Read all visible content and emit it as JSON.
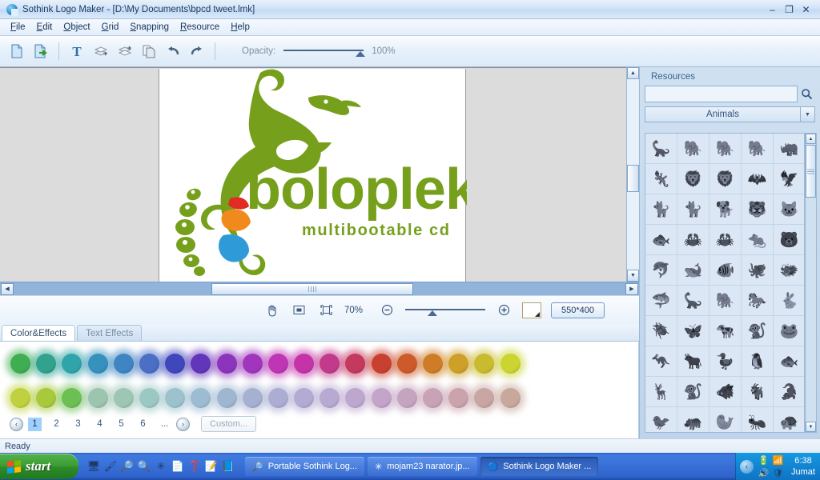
{
  "window": {
    "title": "Sothink Logo Maker - [D:\\My Documents\\bpcd tweet.lmk]",
    "app_icon": "sothink-logo-icon",
    "minimize": "–",
    "restore": "❐",
    "close": "✕"
  },
  "menu": [
    {
      "label": "File",
      "accel": "F"
    },
    {
      "label": "Edit",
      "accel": "E"
    },
    {
      "label": "Object",
      "accel": "O"
    },
    {
      "label": "Grid",
      "accel": "G"
    },
    {
      "label": "Snapping",
      "accel": "S"
    },
    {
      "label": "Resource",
      "accel": "R"
    },
    {
      "label": "Help",
      "accel": "H"
    }
  ],
  "toolbar": {
    "buttons": [
      {
        "name": "new-document-icon",
        "title": "New"
      },
      {
        "name": "export-document-icon",
        "title": "Export"
      },
      {
        "name": "text-tool-icon",
        "title": "Text"
      },
      {
        "name": "bring-forward-icon",
        "title": "Bring Forward"
      },
      {
        "name": "send-backward-icon",
        "title": "Send Backward"
      },
      {
        "name": "duplicate-icon",
        "title": "Duplicate"
      },
      {
        "name": "undo-icon",
        "title": "Undo"
      },
      {
        "name": "redo-icon",
        "title": "Redo"
      }
    ],
    "opacity_label": "Opacity:",
    "opacity_value": "100%"
  },
  "zoombar": {
    "hand_tool": "hand-tool-icon",
    "fit_screen": "fit-to-screen-icon",
    "fit_canvas": "fit-to-canvas-icon",
    "zoom_level": "70%",
    "zoom_out": "−",
    "zoom_in": "+",
    "bg_color": "#ffffff",
    "canvas_size": "550*400"
  },
  "tabs": [
    {
      "label": "Color&Effects",
      "active": true
    },
    {
      "label": "Text Effects",
      "active": false
    }
  ],
  "palette": {
    "row1": [
      "#3fae53",
      "#31a28e",
      "#2fa5a9",
      "#3691bd",
      "#3f85c4",
      "#4a6fc4",
      "#4046bc",
      "#6236bb",
      "#8b35bd",
      "#a235bd",
      "#bf36b5",
      "#c434a8",
      "#c23a8c",
      "#c4395f",
      "#c8402f",
      "#cc5a2a",
      "#cf7c27",
      "#ceA02a",
      "#c9bb2f",
      "#cbd431"
    ],
    "row2": [
      "#c0d13f",
      "#a8c93c",
      "#6cc053",
      "#9cc4ae",
      "#9dc6b4",
      "#9cc8c3",
      "#9cc2cd",
      "#9cbcd2",
      "#9fb6d0",
      "#a6b1d2",
      "#acadd3",
      "#b3abd4",
      "#b8a9d2",
      "#bda7cf",
      "#c2a5c8",
      "#c5a4c0",
      "#c8a3b6",
      "#caa3ad",
      "#c9a5a4",
      "#c8a89c"
    ],
    "pages": [
      "1",
      "2",
      "3",
      "4",
      "5",
      "6"
    ],
    "ellipsis": "...",
    "active_page": "1",
    "prev_arrow": "‹",
    "next_arrow": "›",
    "custom_label": "Custom..."
  },
  "resources": {
    "title": "Resources",
    "search_value": "",
    "search_placeholder": "",
    "search_icon": "search-icon",
    "category": "Animals",
    "dropdown_icon": "chevron-down-icon",
    "items": [
      "dinosaur",
      "elephant-walking",
      "elephant-front",
      "mammoth",
      "rhino",
      "lizard",
      "lion-standing",
      "lion-walking",
      "bat-flying",
      "pterodactyl",
      "cat-climbing",
      "cat-crouching",
      "dog-leaping",
      "tiger-face",
      "cat-face",
      "fish-skeleton",
      "crab",
      "crab-alt",
      "rat",
      "bear",
      "dolphin",
      "whale-swimming",
      "stingray",
      "octopus",
      "dragon",
      "shark",
      "plesiosaur",
      "elephant-side",
      "horse",
      "rabbit",
      "beetle",
      "moth",
      "cow",
      "monkey-hanging",
      "frog",
      "kangaroo",
      "bull",
      "duck",
      "penguin",
      "fish",
      "deer",
      "baboon",
      "boar",
      "goat",
      "crocodile",
      "bird-small",
      "hippo",
      "seal",
      "insect",
      "turtle"
    ]
  },
  "canvas": {
    "logo_title": "boloplek",
    "logo_tagline": "multibootable cd",
    "brand_green": "#76a01c",
    "accent_red": "#e12b23",
    "accent_orange": "#f08a1c",
    "accent_blue": "#2e9bd8"
  },
  "status": {
    "text": "Ready"
  },
  "taskbar": {
    "start_label": "start",
    "quicklaunch": [
      "show-desktop-icon",
      "paint-icon",
      "photo-viewer-icon",
      "search-icon",
      "acdsee-icon",
      "word-icon",
      "help-icon",
      "notepad-icon",
      "dictionary-icon"
    ],
    "tasks": [
      {
        "label": "Portable Sothink Log...",
        "icon": "photo-viewer-icon",
        "active": false
      },
      {
        "label": "mojam23 narator.jp...",
        "icon": "acdsee-icon",
        "active": false
      },
      {
        "label": "Sothink Logo Maker ...",
        "icon": "sothink-logo-icon",
        "active": true
      }
    ],
    "tray_chevron": "‹",
    "tray_icons": [
      "battery-icon",
      "network-icon",
      "volume-icon",
      "antivirus-icon"
    ],
    "clock_time": "6:38",
    "clock_day": "Jumat"
  }
}
